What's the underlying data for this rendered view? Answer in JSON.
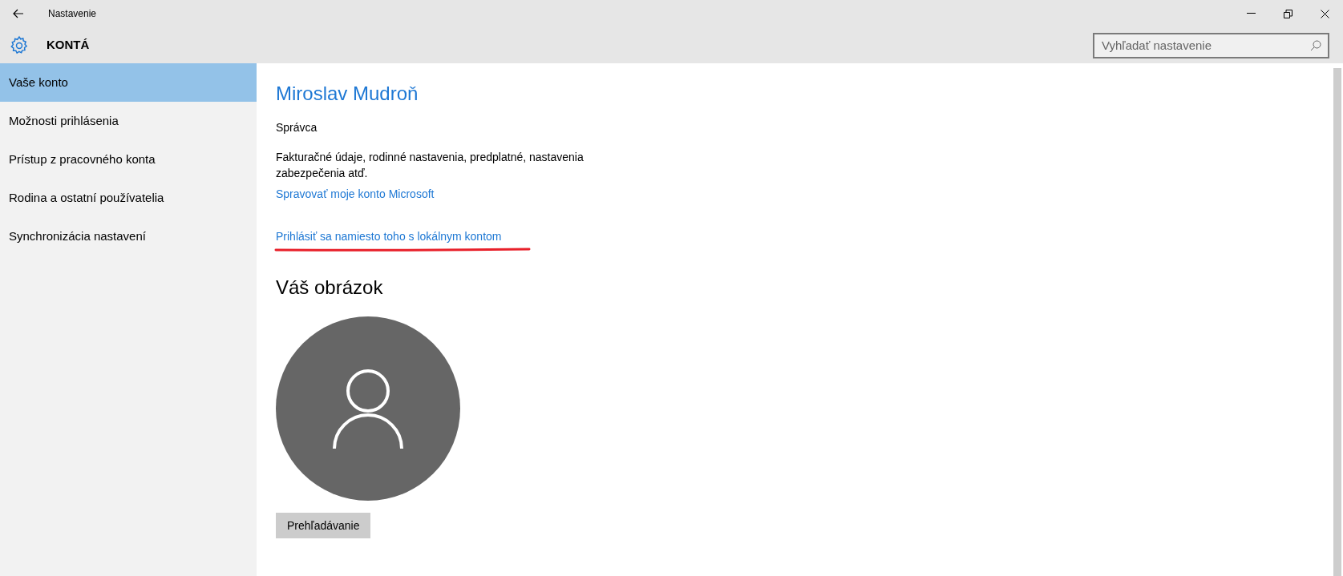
{
  "window": {
    "title": "Nastavenie"
  },
  "header": {
    "title": "KONTÁ"
  },
  "search": {
    "placeholder": "Vyhľadať nastavenie"
  },
  "sidebar": {
    "items": [
      {
        "label": "Vaše konto",
        "selected": true
      },
      {
        "label": "Možnosti prihlásenia",
        "selected": false
      },
      {
        "label": "Prístup z pracovného konta",
        "selected": false
      },
      {
        "label": "Rodina a ostatní používatelia",
        "selected": false
      },
      {
        "label": "Synchronizácia nastavení",
        "selected": false
      }
    ]
  },
  "account": {
    "name": "Miroslav Mudroň",
    "role": "Správca",
    "description": "Fakturačné údaje, rodinné nastavenia, predplatné, nastavenia zabezpečenia atď.",
    "manage_link": "Spravovať moje konto Microsoft",
    "local_link": "Prihlásiť sa namiesto toho s lokálnym kontom"
  },
  "picture": {
    "title": "Váš obrázok",
    "browse_button": "Prehľadávanie"
  }
}
